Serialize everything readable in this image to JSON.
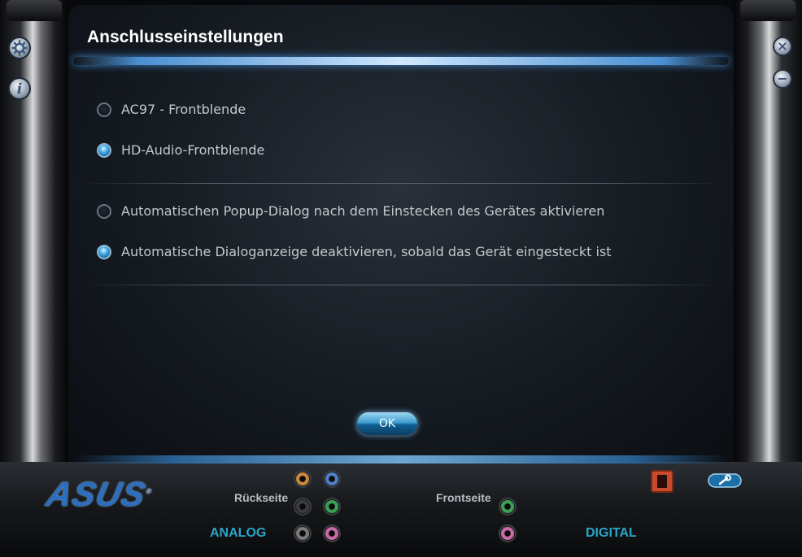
{
  "window": {
    "title": "Anschlusseinstellungen"
  },
  "side_buttons": {
    "settings_icon": "gear-icon",
    "info_icon": "info-icon",
    "close_icon": "close-icon",
    "minimize_icon": "minimize-icon"
  },
  "panel_options": [
    {
      "label": "AC97 - Frontblende",
      "selected": false
    },
    {
      "label": "HD-Audio-Frontblende",
      "selected": true
    }
  ],
  "dialog_options": [
    {
      "label": "Automatischen Popup-Dialog nach dem Einstecken des Gerätes aktivieren",
      "selected": false
    },
    {
      "label": "Automatische Dialoganzeige deaktivieren, sobald das Gerät eingesteckt ist",
      "selected": true
    }
  ],
  "ok_label": "OK",
  "footer": {
    "brand": "ASUS",
    "rear_label": "Rückseite",
    "front_label": "Frontseite",
    "analog_label": "ANALOG",
    "digital_label": "DIGITAL",
    "rear_jacks": [
      "orange",
      "blue",
      "black",
      "green",
      "gray",
      "pink"
    ],
    "front_jacks": [
      "green",
      "pink"
    ]
  },
  "colors": {
    "accent": "#2aa6c8",
    "title_glow": "#4a8fd0",
    "jack_orange": "#c8893e",
    "jack_blue": "#4f7fc8",
    "jack_black": "#3c3c3c",
    "jack_green": "#3aa055",
    "jack_gray": "#7b7b7b",
    "jack_pink": "#c86aa8"
  }
}
